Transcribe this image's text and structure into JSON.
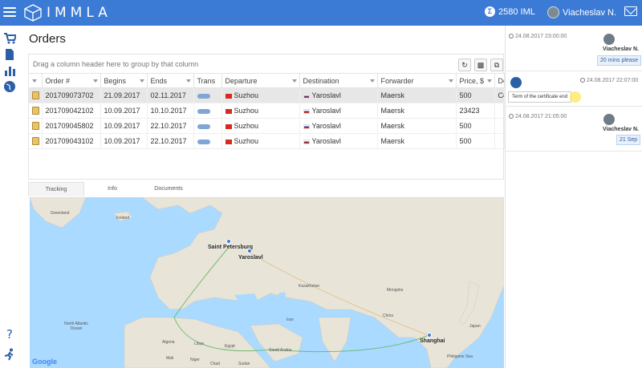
{
  "header": {
    "logo_text": "IMMLA",
    "balance_symbol": "Σ",
    "balance": "2580 IML",
    "user_name": "Viacheslav N."
  },
  "sidebar": {
    "icons": [
      "cart-icon",
      "document-icon",
      "chart-icon",
      "globe-icon",
      "help-icon",
      "runner-icon"
    ]
  },
  "main": {
    "title": "Orders",
    "group_hint": "Drag a column header here to group by that column",
    "columns": [
      "Order #",
      "Begins",
      "Ends",
      "Trans",
      "Departure",
      "Destination",
      "Forwarder",
      "Price, $",
      "De"
    ],
    "rows": [
      {
        "order": "201709073702",
        "begins": "21.09.2017",
        "ends": "02.11.2017",
        "departure": "Suzhou",
        "destination": "Yaroslavl",
        "forwarder": "Maersk",
        "price": "500",
        "extra": "Co"
      },
      {
        "order": "201709042102",
        "begins": "10.09.2017",
        "ends": "10.10.2017",
        "departure": "Suzhou",
        "destination": "Yaroslavl",
        "forwarder": "Maersk",
        "price": "23423",
        "extra": ""
      },
      {
        "order": "201709045802",
        "begins": "10.09.2017",
        "ends": "22.10.2017",
        "departure": "Suzhou",
        "destination": "Yaroslavl",
        "forwarder": "Maersk",
        "price": "500",
        "extra": ""
      },
      {
        "order": "201709043102",
        "begins": "10.09.2017",
        "ends": "22.10.2017",
        "departure": "Suzhou",
        "destination": "Yaroslavl",
        "forwarder": "Maersk",
        "price": "500",
        "extra": ""
      }
    ],
    "tabs": [
      "Tracking",
      "Info",
      "Documents"
    ]
  },
  "map": {
    "cities": [
      "Saint Petersburg",
      "Yaroslavl",
      "Shanghai"
    ],
    "labels": [
      "Greenland",
      "Iceland",
      "Kazakhstan",
      "Mongolia",
      "China",
      "Iran",
      "Egypt",
      "Libya",
      "Algeria",
      "Mali",
      "Niger",
      "Chad",
      "Sudan",
      "Saudi Arabia",
      "Japan",
      "North Atlantic Ocean",
      "Philippine Sea"
    ],
    "attribution": "Google"
  },
  "chat": {
    "messages": [
      {
        "time": "24.08.2017 23:00:00",
        "author": "Viacheslav N.",
        "text": "20 mins please"
      },
      {
        "time": "24.08.2017 22:07:00",
        "author": "",
        "text": "Term of the certificate end"
      },
      {
        "time": "24.08.2017 21:05:00",
        "author": "Viacheslav N.",
        "text": "21 Sep"
      }
    ]
  }
}
